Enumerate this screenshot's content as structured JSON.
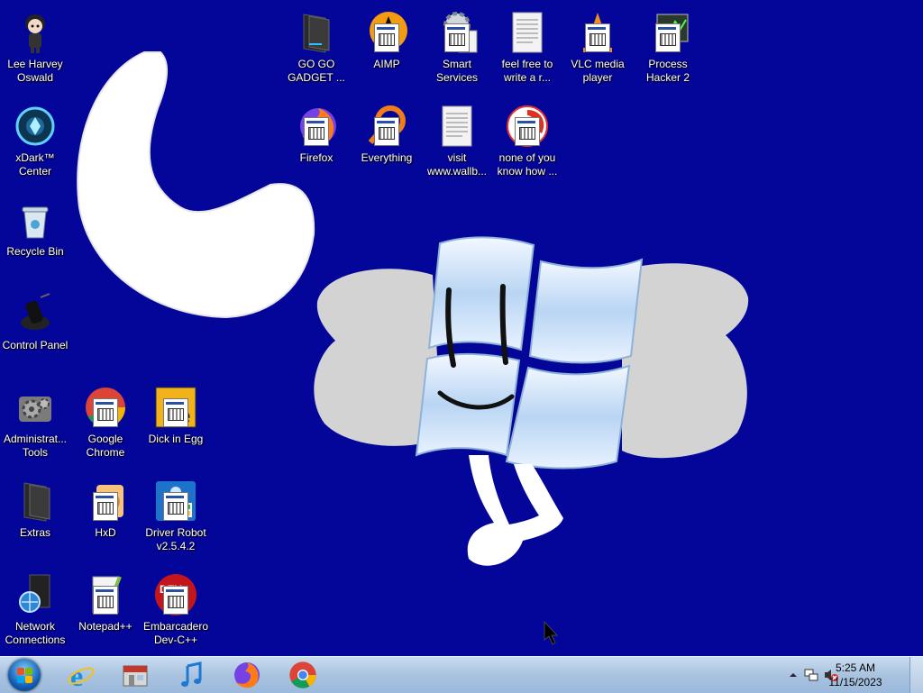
{
  "desktop": {
    "icons": [
      {
        "label": "Lee Harvey Oswald",
        "icon": "character-icon"
      },
      {
        "label": "xDark™ Center",
        "icon": "xdark-icon"
      },
      {
        "label": "Recycle Bin",
        "icon": "recycle-bin-icon"
      },
      {
        "label": "Control Panel",
        "icon": "control-panel-icon"
      },
      {
        "label": "Administrat... Tools",
        "icon": "admin-tools-icon"
      },
      {
        "label": "Extras",
        "icon": "folder-icon"
      },
      {
        "label": "Network Connections",
        "icon": "network-icon"
      },
      {
        "label": "Google Chrome",
        "icon": "chrome-icon"
      },
      {
        "label": "HxD",
        "icon": "hxd-icon"
      },
      {
        "label": "Notepad++",
        "icon": "notepadpp-icon"
      },
      {
        "label": "Dick in Egg",
        "icon": "app-icon"
      },
      {
        "label": "Driver Robot v2.5.4.2",
        "icon": "driver-robot-icon"
      },
      {
        "label": "Embarcadero Dev-C++",
        "icon": "devcpp-icon"
      },
      {
        "label": "GO GO GADGET ...",
        "icon": "folder-icon"
      },
      {
        "label": "AIMP",
        "icon": "aimp-icon"
      },
      {
        "label": "Smart Services",
        "icon": "gear-icon"
      },
      {
        "label": "feel free to write a r...",
        "icon": "text-file-icon"
      },
      {
        "label": "VLC media player",
        "icon": "vlc-icon"
      },
      {
        "label": "Process Hacker 2",
        "icon": "process-hacker-icon"
      },
      {
        "label": "Firefox",
        "icon": "firefox-icon"
      },
      {
        "label": "Everything",
        "icon": "everything-icon"
      },
      {
        "label": "visit www.wallb...",
        "icon": "text-file-icon"
      },
      {
        "label": "none of you know how ...",
        "icon": "app-icon"
      }
    ]
  },
  "taskbar": {
    "pinned": [
      {
        "name": "Internet Explorer",
        "icon": "ie-icon"
      },
      {
        "name": "Store",
        "icon": "store-icon"
      },
      {
        "name": "Music",
        "icon": "music-icon"
      },
      {
        "name": "Firefox",
        "icon": "firefox-icon"
      },
      {
        "name": "Google Chrome",
        "icon": "chrome-icon"
      }
    ],
    "clock": {
      "time": "5:25 AM",
      "date": "11/15/2023"
    }
  },
  "colors": {
    "desktop": "#04069a",
    "taskbar": "#a9c3e0"
  }
}
